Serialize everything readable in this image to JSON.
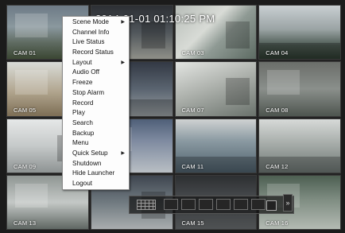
{
  "timestamp": "2014-01-01 01:10:25 PM",
  "cameras": [
    {
      "label": "CAM 01"
    },
    {
      "label": ""
    },
    {
      "label": "CAM 03"
    },
    {
      "label": "CAM 04"
    },
    {
      "label": "CAM 05"
    },
    {
      "label": ""
    },
    {
      "label": "CAM 07"
    },
    {
      "label": "CAM 08"
    },
    {
      "label": "CAM 09"
    },
    {
      "label": ""
    },
    {
      "label": "CAM 11"
    },
    {
      "label": "CAM 12"
    },
    {
      "label": "CAM 13"
    },
    {
      "label": ""
    },
    {
      "label": "CAM 15"
    },
    {
      "label": "CAM 16"
    }
  ],
  "context_menu": {
    "items": [
      {
        "label": "Scene Mode",
        "submenu": true
      },
      {
        "label": "Channel Info",
        "submenu": false
      },
      {
        "label": "Live Status",
        "submenu": false
      },
      {
        "label": "Record Status",
        "submenu": false
      },
      {
        "label": "Layout",
        "submenu": true
      },
      {
        "label": "Audio Off",
        "submenu": false
      },
      {
        "label": "Freeze",
        "submenu": false
      },
      {
        "label": "Stop Alarm",
        "submenu": false
      },
      {
        "label": "Record",
        "submenu": false
      },
      {
        "label": "Play",
        "submenu": false
      },
      {
        "label": "Search",
        "submenu": false
      },
      {
        "label": "Backup",
        "submenu": false
      },
      {
        "label": "Menu",
        "submenu": false
      },
      {
        "label": "Quick Setup",
        "submenu": true
      },
      {
        "label": "Shutdown",
        "submenu": false
      },
      {
        "label": "Hide Launcher",
        "submenu": false
      },
      {
        "label": "Logout",
        "submenu": false
      }
    ],
    "submenu_arrow": "▶"
  },
  "launcher": {
    "more_symbol": "»",
    "icons": [
      "layout-grid-icon",
      "channel-button",
      "check-icon",
      "expand-icon"
    ]
  }
}
